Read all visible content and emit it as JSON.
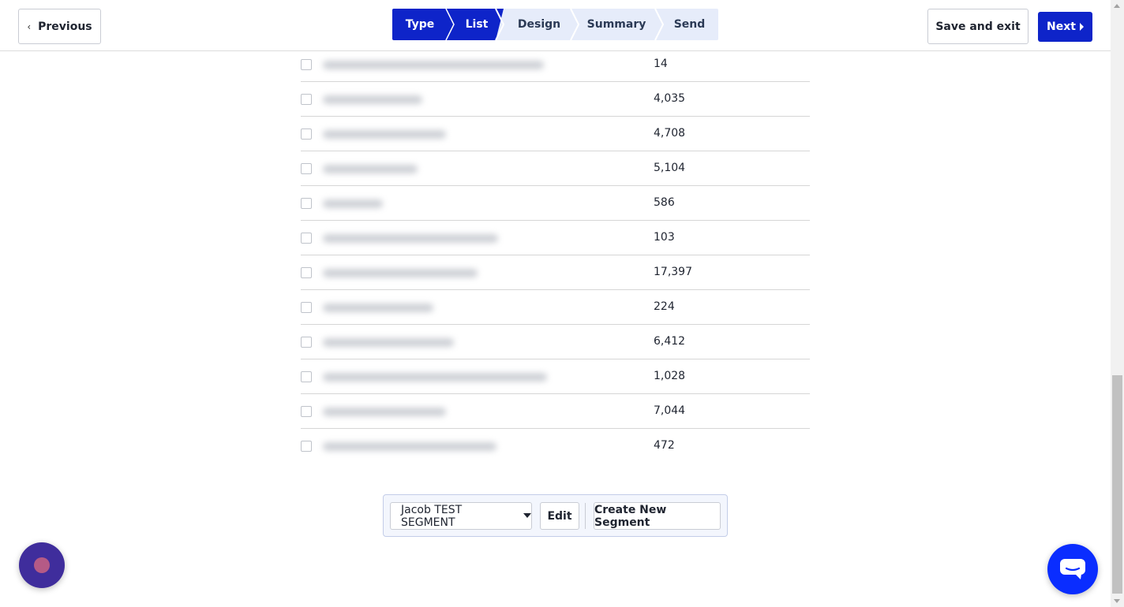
{
  "header": {
    "previous_label": "Previous",
    "save_exit_label": "Save and exit",
    "next_label": "Next"
  },
  "stepper": {
    "steps": [
      {
        "label": "Type",
        "state": "active"
      },
      {
        "label": "List",
        "state": "active"
      },
      {
        "label": "Design",
        "state": "inactive"
      },
      {
        "label": "Summary",
        "state": "inactive"
      },
      {
        "label": "Send",
        "state": "inactive"
      }
    ],
    "active_color": "#0e24c9",
    "inactive_color": "#e6ecfa"
  },
  "lists": {
    "rows": [
      {
        "count": "14"
      },
      {
        "count": "4,035"
      },
      {
        "count": "4,708"
      },
      {
        "count": "5,104"
      },
      {
        "count": "586"
      },
      {
        "count": "103"
      },
      {
        "count": "17,397"
      },
      {
        "count": "224"
      },
      {
        "count": "6,412"
      },
      {
        "count": "1,028"
      },
      {
        "count": "7,044"
      },
      {
        "count": "472"
      }
    ]
  },
  "segment": {
    "selected": "Jacob TEST SEGMENT",
    "edit_label": "Edit",
    "create_label": "Create New Segment"
  },
  "widgets": {
    "left_widget_icon": "assistant-bubble-icon",
    "right_widget_icon": "chat-icon"
  }
}
